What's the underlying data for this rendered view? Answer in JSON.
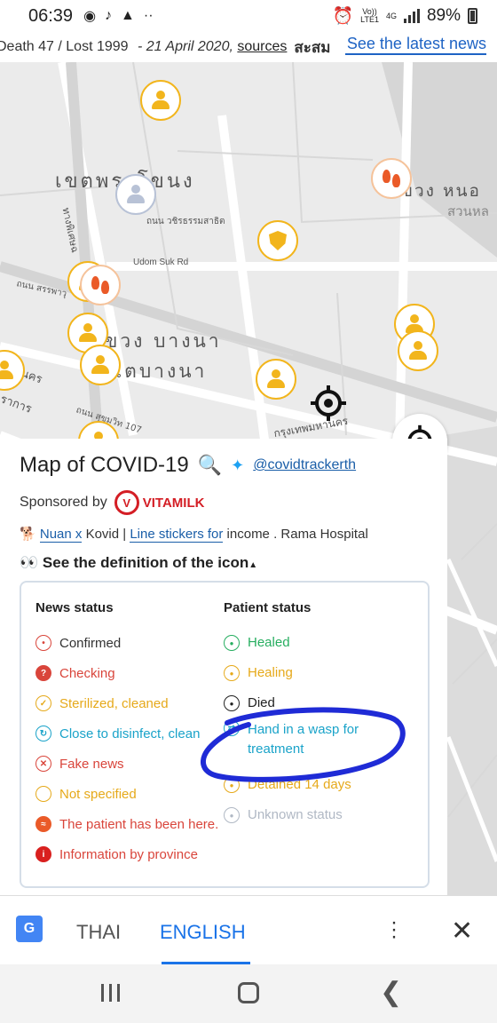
{
  "status_bar": {
    "time": "06:39",
    "network_top": "Vo))",
    "network_bottom": "LTE1",
    "network_type": "4G",
    "battery": "89%"
  },
  "ticker": {
    "stats": "Death 47 / Lost 1999",
    "date": "21 April 2020,",
    "sources": "sources",
    "thai_text": "สะสม",
    "latest_link": "See the latest news"
  },
  "map_labels": {
    "district1": "เขตพระโขนง",
    "district2_a": "ขวง บางนา",
    "district2_b": "เตบางนา",
    "district3": "ขวง หนอ",
    "district3_sub": "สวนหล",
    "road1": "ถนน วชิรธรรมสาธิต",
    "road2": "Udom Suk Rd",
    "road3": "ถนน สรรพาวุ",
    "road4": "ทางพิเศษฉ",
    "road5": "หานคร",
    "road6": "ราการ",
    "road7": "ถนน สุขุมวิท 107",
    "road8": "กรุงเทพมหานคร"
  },
  "panel": {
    "title": "Map of COVID-19",
    "twitter_handle": "@covidtrackerth",
    "sponsored_by": "Sponsored by",
    "sponsor_name": "VITAMILK",
    "link1": "Nuan x",
    "text1": "Kovid |",
    "link2": "Line stickers for",
    "text2": "income . Rama Hospital",
    "definition_label": "See the definition of the icon"
  },
  "legend": {
    "news_title": "News status",
    "patient_title": "Patient status",
    "news_items": [
      {
        "label": "Confirmed",
        "color": "#333333",
        "icon_color": "#d9453b"
      },
      {
        "label": "Checking",
        "color": "#d9453b",
        "icon_color": "#d9453b"
      },
      {
        "label": "Sterilized, cleaned",
        "color": "#e6a91a",
        "icon_color": "#e6a91a"
      },
      {
        "label": "Close to disinfect, clean",
        "color": "#1aa3c9",
        "icon_color": "#1aa3c9"
      },
      {
        "label": "Fake news",
        "color": "#d9453b",
        "icon_color": "#d9453b"
      },
      {
        "label": "Not specified",
        "color": "#e6a91a",
        "icon_color": "#e6a91a"
      },
      {
        "label": "The patient has been here.",
        "color": "#d9453b",
        "icon_color": "#ea5a28"
      },
      {
        "label": "Information by province",
        "color": "#d9453b",
        "icon_color": "#d9201f"
      }
    ],
    "patient_items": [
      {
        "label": "Healed",
        "color": "#27ae60",
        "icon_color": "#27ae60"
      },
      {
        "label": "Healing",
        "color": "#e6a91a",
        "icon_color": "#e6a91a"
      },
      {
        "label": "Died",
        "color": "#222222",
        "icon_color": "#222222"
      },
      {
        "label": "Hand in a wasp for",
        "label2": "treatment",
        "color": "#1aa3c9",
        "icon_color": "#1aa3c9"
      },
      {
        "label": "Detained 14 days",
        "color": "#e6a91a",
        "icon_color": "#e6a91a"
      },
      {
        "label": "Unknown status",
        "color": "#b0b8c4",
        "icon_color": "#b0b8c4"
      }
    ]
  },
  "translate_bar": {
    "lang_source": "THAI",
    "lang_target": "ENGLISH"
  }
}
